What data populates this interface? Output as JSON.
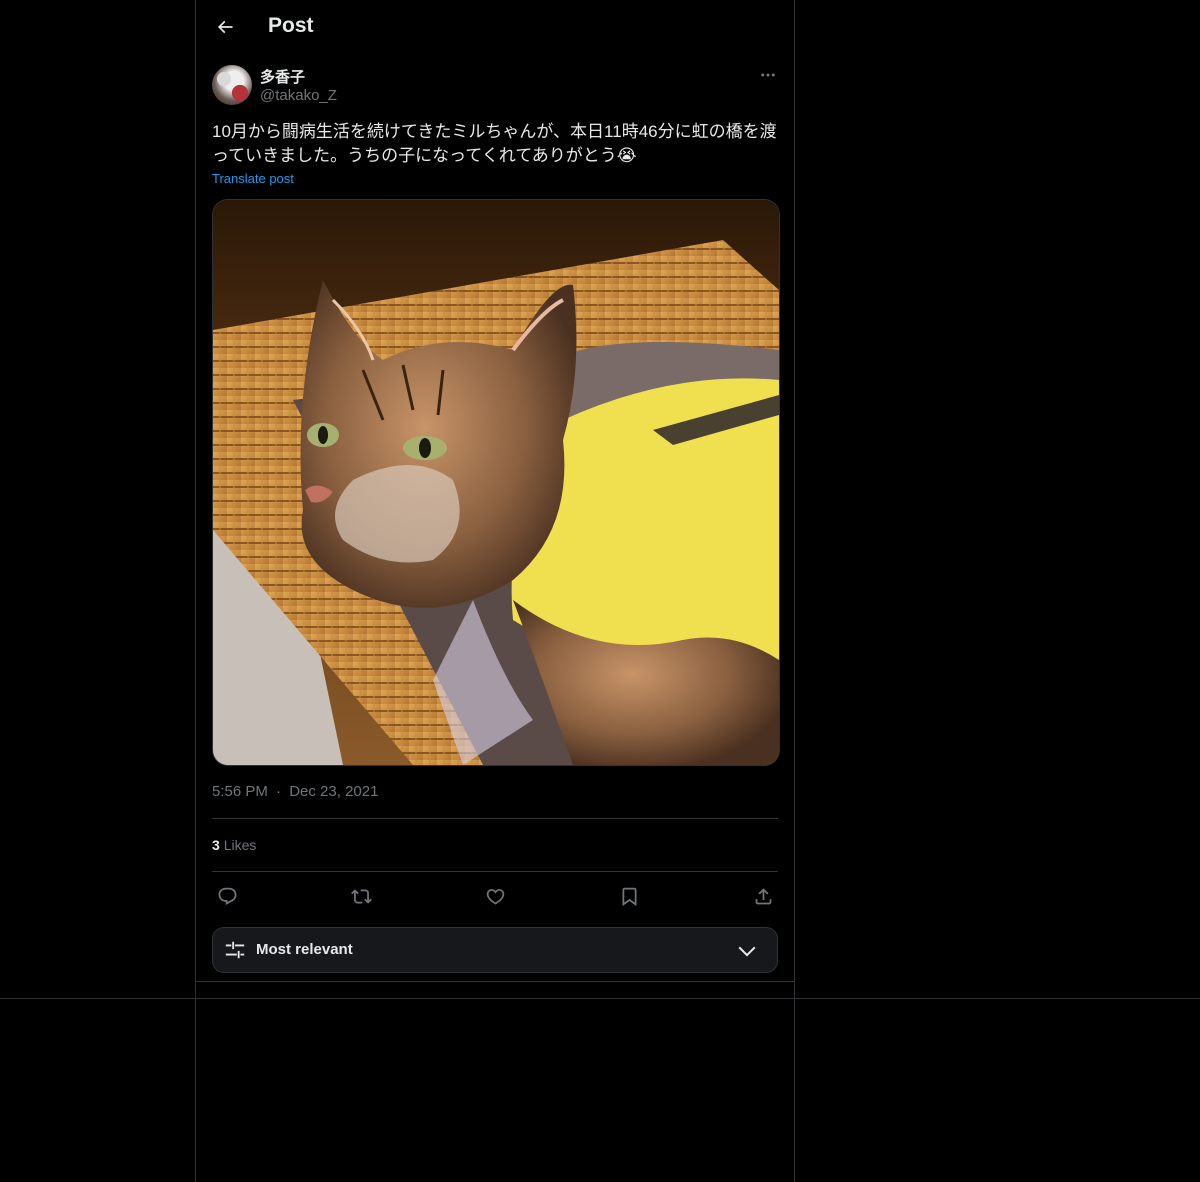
{
  "header": {
    "title": "Post",
    "back_label": "Back"
  },
  "author": {
    "display_name": "多香子",
    "handle": "@takako_Z"
  },
  "post": {
    "text": "10月から闘病生活を続けてきたミルちゃんが、本日11時46分に虹の橋を渡っていきました。うちの子になってくれてありがとう😭",
    "translate_label": "Translate post",
    "time": "5:56 PM",
    "separator": "·",
    "date": "Dec 23, 2021"
  },
  "stats": {
    "likes_count": "3",
    "likes_label": "Likes"
  },
  "sort": {
    "label": "Most relevant"
  },
  "icons": [
    "back-arrow-icon",
    "more-icon",
    "reply-icon",
    "repost-icon",
    "like-icon",
    "bookmark-icon",
    "share-icon",
    "sliders-icon",
    "chevron-down-icon"
  ],
  "colors": {
    "background": "#000000",
    "text": "#e7e9ea",
    "muted": "#71767b",
    "link": "#1d9bf0",
    "border": "#2f3336"
  }
}
